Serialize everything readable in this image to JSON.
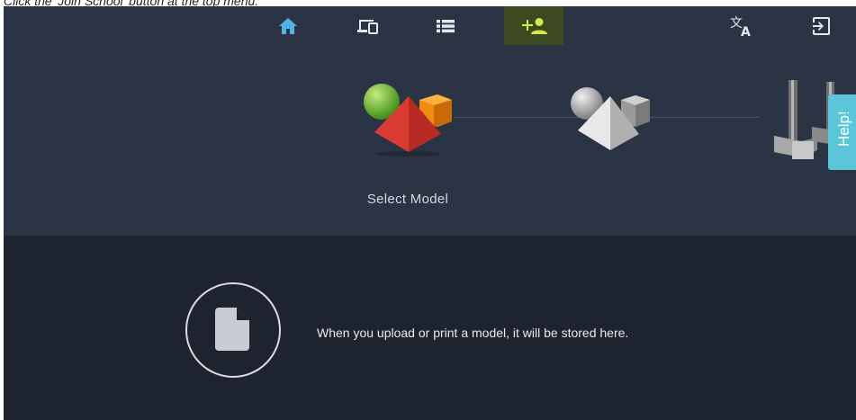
{
  "instruction": "Click the 'Join School' button at the top menu.",
  "nav": {
    "items": [
      {
        "name": "home",
        "icon": "home-icon",
        "color": "#4fb3e8"
      },
      {
        "name": "devices",
        "icon": "devices-icon",
        "color": "#e6e8ec"
      },
      {
        "name": "list",
        "icon": "list-icon",
        "color": "#e6e8ec"
      },
      {
        "name": "join-school",
        "icon": "add-person-icon",
        "color": "#d6e84a",
        "active": true
      },
      {
        "name": "language",
        "icon": "translate-icon",
        "color": "#e6e8ec"
      },
      {
        "name": "logout",
        "icon": "logout-icon",
        "color": "#e6e8ec"
      }
    ]
  },
  "steps": {
    "select_model_label": "Select Model"
  },
  "empty_state": {
    "message": "When you upload or print a model, it will be stored here."
  },
  "help": {
    "label": "Help!"
  },
  "colors": {
    "top_bg": "#2b3444",
    "bottom_bg": "#1d232f",
    "accent": "#d6e84a",
    "help_bg": "#5bc6d9"
  }
}
